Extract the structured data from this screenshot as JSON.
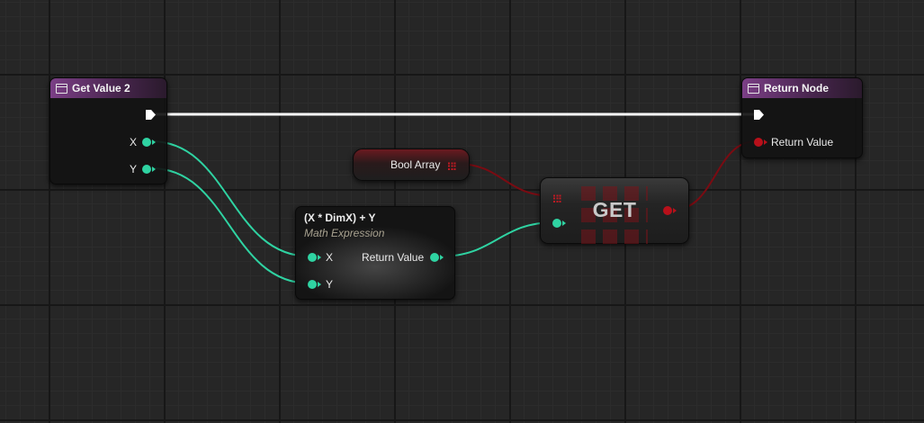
{
  "nodes": {
    "get_value": {
      "title": "Get Value 2",
      "pins": {
        "x": "X",
        "y": "Y"
      }
    },
    "return_node": {
      "title": "Return Node",
      "pins": {
        "return_value": "Return Value"
      }
    },
    "math_expression": {
      "title": "(X * DimX) + Y",
      "subtitle": "Math Expression",
      "pins": {
        "x": "X",
        "y": "Y",
        "return_value": "Return Value"
      }
    },
    "bool_array": {
      "label": "Bool Array"
    },
    "get": {
      "label": "GET"
    }
  },
  "colors": {
    "integer_pin": "#2fd3a2",
    "boolean_pin": "#b8101a",
    "exec_wire": "#ffffff",
    "function_header": "#7b3f86"
  },
  "icons": [
    "function-icon",
    "exec-pin-icon",
    "array-pin-icon"
  ]
}
